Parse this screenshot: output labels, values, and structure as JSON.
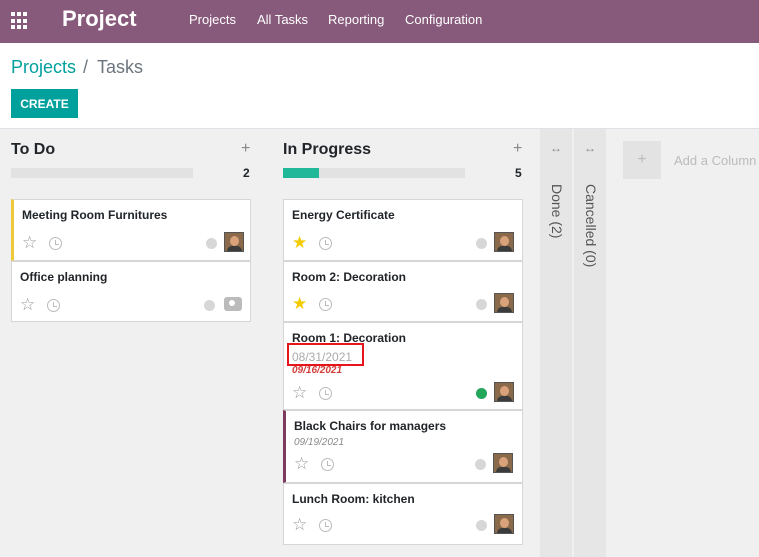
{
  "topbar": {
    "brand": "Project",
    "menu": [
      "Projects",
      "All Tasks",
      "Reporting",
      "Configuration"
    ]
  },
  "breadcrumb": {
    "link": "Projects",
    "separator": "/",
    "current": "Tasks"
  },
  "create_label": "CREATE",
  "columns": [
    {
      "title": "To Do",
      "plus": "+",
      "count": "2",
      "progress": 0,
      "cards": [
        {
          "title": "Meeting Room Furnitures",
          "starred": false
        },
        {
          "title": "Office planning",
          "starred": false
        }
      ]
    },
    {
      "title": "In Progress",
      "plus": "+",
      "count": "5",
      "progress": 0.2,
      "cards": [
        {
          "title": "Energy Certificate",
          "starred": true
        },
        {
          "title": "Room 2: Decoration",
          "starred": true
        },
        {
          "title": "Room 1: Decoration",
          "date_overlay": "08/31/2021",
          "deadline": "09/16/2021",
          "starred": false
        },
        {
          "title": "Black Chairs for managers",
          "deadline": "09/19/2021",
          "starred": false
        },
        {
          "title": "Lunch Room: kitchen",
          "starred": false
        }
      ]
    }
  ],
  "folded_columns": [
    {
      "title": "Done (2)",
      "arrow": "↔"
    },
    {
      "title": "Cancelled (0)",
      "arrow": "↔"
    }
  ],
  "add_column": {
    "plus": "+",
    "label": "Add a Column"
  },
  "colors": {
    "topbar": "#875a7b",
    "accent": "#00a09d",
    "progress": "#21b799",
    "highlight": "#e8141b"
  }
}
